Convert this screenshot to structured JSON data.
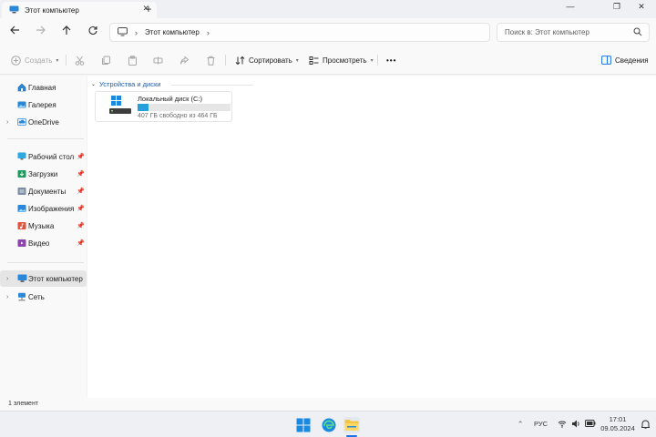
{
  "window": {
    "tab_title": "Этот компьютер",
    "tab_icon": "monitor-icon",
    "new_tab_symbol": "+"
  },
  "navigation": {
    "address_segments": [
      "Этот компьютер"
    ],
    "search_placeholder": "Поиск в: Этот компьютер"
  },
  "commandbar": {
    "create_label": "Создать",
    "sort_label": "Сортировать",
    "view_label": "Просмотреть",
    "details_label": "Сведения",
    "more_symbol": "•••"
  },
  "sidebar": {
    "top": [
      {
        "label": "Главная",
        "icon": "home-icon"
      },
      {
        "label": "Галерея",
        "icon": "gallery-icon"
      },
      {
        "label": "OneDrive",
        "icon": "onedrive-icon"
      }
    ],
    "quick_access": [
      {
        "label": "Рабочий стол",
        "icon": "desktop-folder-icon"
      },
      {
        "label": "Загрузки",
        "icon": "downloads-folder-icon"
      },
      {
        "label": "Документы",
        "icon": "documents-folder-icon"
      },
      {
        "label": "Изображения",
        "icon": "pictures-folder-icon"
      },
      {
        "label": "Музыка",
        "icon": "music-folder-icon"
      },
      {
        "label": "Видео",
        "icon": "videos-folder-icon"
      }
    ],
    "bottom": [
      {
        "label": "Этот компьютер",
        "icon": "monitor-icon",
        "selected": true
      },
      {
        "label": "Сеть",
        "icon": "network-icon"
      }
    ]
  },
  "content": {
    "group_title": "Устройства и диски",
    "drive": {
      "name": "Локальный диск (C:)",
      "free_text": "407 ГБ свободно из 464 ГБ",
      "used_fraction": 0.12,
      "bar_color": "#26a0da"
    }
  },
  "status": {
    "item_count": "1 элемент"
  },
  "taskbar": {
    "language": "РУС",
    "time": "17:01",
    "date": "09.05.2024"
  },
  "colors": {
    "accent": "#1a73e8",
    "group_header": "#1a5fb4"
  }
}
